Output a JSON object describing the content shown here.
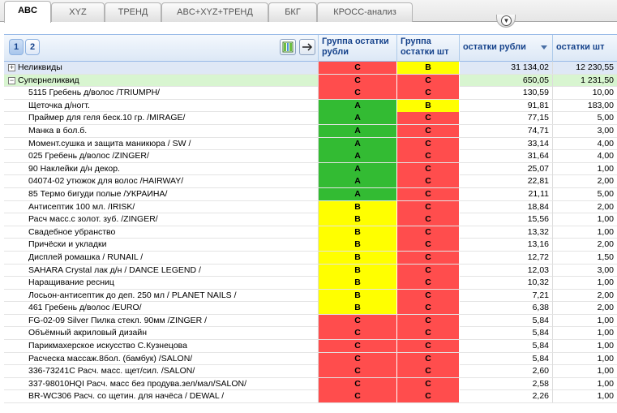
{
  "tabs": [
    {
      "label": "ABC",
      "active": true
    },
    {
      "label": "XYZ",
      "active": false
    },
    {
      "label": "ТРЕНД",
      "active": false
    },
    {
      "label": "ABC+XYZ+ТРЕНД",
      "active": false
    },
    {
      "label": "БКГ",
      "active": false
    },
    {
      "label": "КРОСС-анализ",
      "active": false
    }
  ],
  "pager": {
    "pages": [
      "1",
      "2"
    ],
    "current": "1"
  },
  "columns": {
    "group_rub": "Группа остатки рубли",
    "group_qty": "Группа остатки шт",
    "rub": "остатки рубли",
    "qty": "остатки шт"
  },
  "groups": [
    {
      "name": "Неликвиды",
      "expander": "+",
      "g1": "C",
      "g2": "B",
      "rub": "31 134,02",
      "qty": "12 230,55"
    },
    {
      "name": "Супернеликвид",
      "expander": "−",
      "g1": "C",
      "g2": "C",
      "rub": "650,05",
      "qty": "1 231,50"
    }
  ],
  "rows": [
    {
      "name": "5115 Гребень д/волос /TRIUMPH/",
      "g1": "C",
      "g2": "C",
      "rub": "130,59",
      "qty": "10,00"
    },
    {
      "name": "Щеточка д/ногт.",
      "g1": "A",
      "g2": "B",
      "rub": "91,81",
      "qty": "183,00"
    },
    {
      "name": "Праймер для геля беск.10 гр. /MIRAGE/",
      "g1": "A",
      "g2": "C",
      "rub": "77,15",
      "qty": "5,00"
    },
    {
      "name": "Манка в бол.б.",
      "g1": "A",
      "g2": "C",
      "rub": "74,71",
      "qty": "3,00"
    },
    {
      "name": "Момент.сушка и защита маникюра / SW /",
      "g1": "A",
      "g2": "C",
      "rub": "33,14",
      "qty": "4,00"
    },
    {
      "name": "025 Гребень д/волос  /ZINGER/",
      "g1": "A",
      "g2": "C",
      "rub": "31,64",
      "qty": "4,00"
    },
    {
      "name": "90 Наклейки д/н декор.",
      "g1": "A",
      "g2": "C",
      "rub": "25,07",
      "qty": "1,00"
    },
    {
      "name": "04074-02 утюжок для волос /HAIRWAY/",
      "g1": "A",
      "g2": "C",
      "rub": "22,81",
      "qty": "2,00"
    },
    {
      "name": "85 Термо бигуди полые /УКРАИНА/",
      "g1": "A",
      "g2": "C",
      "rub": "21,11",
      "qty": "5,00"
    },
    {
      "name": "Антисептик 100 мл. /IRISK/",
      "g1": "B",
      "g2": "C",
      "rub": "18,84",
      "qty": "2,00"
    },
    {
      "name": "Расч масс.с золот. зуб. /ZINGER/",
      "g1": "B",
      "g2": "C",
      "rub": "15,56",
      "qty": "1,00"
    },
    {
      "name": "Свадебное убранство",
      "g1": "B",
      "g2": "C",
      "rub": "13,32",
      "qty": "1,00"
    },
    {
      "name": "Причёски и укладки",
      "g1": "B",
      "g2": "C",
      "rub": "13,16",
      "qty": "2,00"
    },
    {
      "name": "Дисплей ромашка / RUNAIL /",
      "g1": "B",
      "g2": "C",
      "rub": "12,72",
      "qty": "1,50"
    },
    {
      "name": "SAHARA Crystal лак д/н / DANCE LEGEND /",
      "g1": "B",
      "g2": "C",
      "rub": "12,03",
      "qty": "3,00"
    },
    {
      "name": "Наращивание ресниц",
      "g1": "B",
      "g2": "C",
      "rub": "10,32",
      "qty": "1,00"
    },
    {
      "name": "Лосьон-антисептик  до деп. 250 мл / PLANET NAILS /",
      "g1": "B",
      "g2": "C",
      "rub": "7,21",
      "qty": "2,00"
    },
    {
      "name": "461 Гребень д/волос /EURO/",
      "g1": "B",
      "g2": "C",
      "rub": "6,38",
      "qty": "2,00"
    },
    {
      "name": "FG-02-09 Silver Пилка стекл. 90мм  /ZINGER /",
      "g1": "C",
      "g2": "C",
      "rub": "5,84",
      "qty": "1,00"
    },
    {
      "name": "Объёмный акриловый дизайн",
      "g1": "C",
      "g2": "C",
      "rub": "5,84",
      "qty": "1,00"
    },
    {
      "name": "Парикмахерское искусство С.Кузнецова",
      "g1": "C",
      "g2": "C",
      "rub": "5,84",
      "qty": "1,00"
    },
    {
      "name": "Расческа массаж.8бол. (бамбук) /SALON/",
      "g1": "C",
      "g2": "C",
      "rub": "5,84",
      "qty": "1,00"
    },
    {
      "name": "336-73241C Расч. масс. щет/сил. /SALON/",
      "g1": "C",
      "g2": "C",
      "rub": "2,60",
      "qty": "1,00"
    },
    {
      "name": "337-98010HQI Расч. масс без продува.зел/мал/SALON/",
      "g1": "C",
      "g2": "C",
      "rub": "2,58",
      "qty": "1,00"
    },
    {
      "name": "BR-WC306 Расч. со щетин. для начёса / DEWAL /",
      "g1": "C",
      "g2": "C",
      "rub": "2,26",
      "qty": "1,00"
    }
  ],
  "colors": {
    "A": "#33bb33",
    "B": "#ffff00",
    "C": "#ff4d4d"
  }
}
